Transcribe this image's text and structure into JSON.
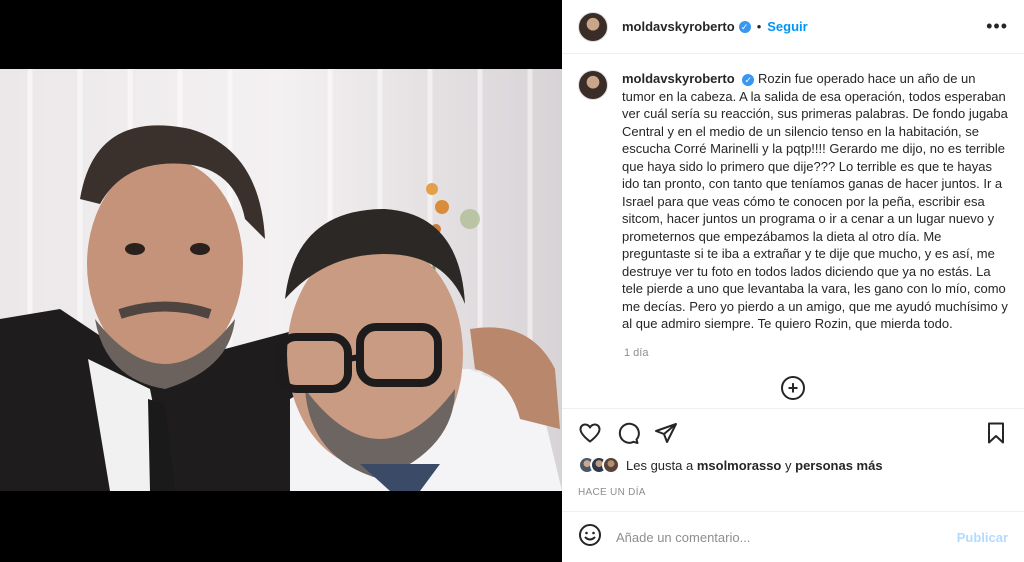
{
  "post": {
    "username": "moldavskyroberto",
    "verified_mark": "✓",
    "separator": "•",
    "follow_label": "Seguir",
    "more_label": "•••",
    "caption": "Rozin fue operado hace un año de un tumor en la cabeza. A la salida de esa operación, todos esperaban ver cuál sería su reacción, sus primeras palabras. De fondo jugaba Central y en el medio de un silencio tenso en la habitación, se escucha Corré Marinelli y la pqtp!!!! Gerardo me dijo, no es terrible que haya sido lo primero que dije??? Lo terrible es que te hayas ido tan pronto, con tanto que teníamos ganas de hacer juntos. Ir a Israel para que veas cómo te conocen por la peña, escribir esa sitcom, hacer juntos un programa o ir a cenar a un lugar nuevo y prometernos que empezábamos la dieta al otro día. Me preguntaste si te iba a extrañar y te dije que mucho, y es así, me destruye ver tu foto en todos lados diciendo que ya no estás. La tele pierde a uno que levantaba la vara, les gano con lo mío, como me decías. Pero yo pierdo a un amigo, que me ayudó muchísimo y al que admiro siempre. Te quiero Rozin, que mierda todo.",
    "caption_age": "1 día",
    "load_more_label": "+",
    "likes": {
      "prefix": "Les gusta a",
      "user": "msolmorasso",
      "conj": "y",
      "others": "personas más"
    },
    "date_label": "HACE UN DÍA",
    "comment": {
      "placeholder": "Añade un comentario...",
      "value": "",
      "publish_label": "Publicar"
    }
  },
  "icons": {
    "like": "heart-icon",
    "comment": "comment-icon",
    "share": "share-icon",
    "save": "bookmark-icon",
    "emoji": "emoji-icon",
    "more": "more-icon",
    "add": "plus-circle-icon"
  },
  "colors": {
    "accent": "#0095f6",
    "verified": "#3897f0",
    "muted": "#8e8e8e",
    "publish_disabled": "#b3dbff",
    "border": "#efefef"
  }
}
